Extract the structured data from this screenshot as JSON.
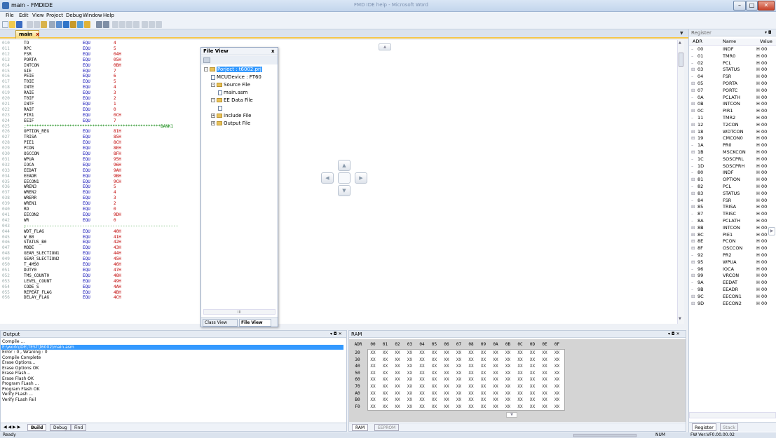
{
  "window": {
    "title": "main - FMDIDE"
  },
  "titlebar": {
    "faded_text": "FMD IDE help - Microsoft Word"
  },
  "menu": [
    "File",
    "Edit",
    "View",
    "Project",
    "Debug",
    "Window",
    "Help"
  ],
  "editor_tab": {
    "label": "main",
    "close": "x"
  },
  "editor": {
    "lines": [
      {
        "n": "010",
        "a": "TO",
        "b": "EQU",
        "c": "4"
      },
      {
        "n": "011",
        "a": "RPC",
        "b": "EQU",
        "c": "5"
      },
      {
        "n": "012",
        "a": "FSR",
        "b": "EQU",
        "c": "04H"
      },
      {
        "n": "013",
        "a": "PORTA",
        "b": "EQU",
        "c": "05H"
      },
      {
        "n": "014",
        "a": "INTCON",
        "b": "EQU",
        "c": "0BH"
      },
      {
        "n": "015",
        "a": "GIE",
        "b": "EQU",
        "c": "7"
      },
      {
        "n": "016",
        "a": "PEIE",
        "b": "EQU",
        "c": "6"
      },
      {
        "n": "017",
        "a": "T0IE",
        "b": "EQU",
        "c": "5"
      },
      {
        "n": "018",
        "a": "INTE",
        "b": "EQU",
        "c": "4"
      },
      {
        "n": "019",
        "a": "RAIE",
        "b": "EQU",
        "c": "3"
      },
      {
        "n": "020",
        "a": "T0IF",
        "b": "EQU",
        "c": "2"
      },
      {
        "n": "021",
        "a": "INTF",
        "b": "EQU",
        "c": "1"
      },
      {
        "n": "022",
        "a": "RAIF",
        "b": "EQU",
        "c": "0"
      },
      {
        "n": "023",
        "a": "PIR1",
        "b": "EQU",
        "c": "0CH"
      },
      {
        "n": "024",
        "a": "EEIF",
        "b": "EQU",
        "c": "7"
      },
      {
        "n": "025",
        "comment": ";*****************************************************BANK1"
      },
      {
        "n": "026",
        "a": "OPTION_REG",
        "b": "EQU",
        "c": "81H"
      },
      {
        "n": "027",
        "a": "TRISA",
        "b": "EQU",
        "c": "85H"
      },
      {
        "n": "028",
        "a": "PIE1",
        "b": "EQU",
        "c": "8CH"
      },
      {
        "n": "029",
        "a": "PCON",
        "b": "EQU",
        "c": "8EH"
      },
      {
        "n": "030",
        "a": "OSCCON",
        "b": "EQU",
        "c": "8FH"
      },
      {
        "n": "031",
        "a": "WPUA",
        "b": "EQU",
        "c": "95H"
      },
      {
        "n": "032",
        "a": "IOCA",
        "b": "EQU",
        "c": "96H"
      },
      {
        "n": "033",
        "a": "EEDAT",
        "b": "EQU",
        "c": "9AH"
      },
      {
        "n": "034",
        "a": "EEADR",
        "b": "EQU",
        "c": "9BH"
      },
      {
        "n": "035",
        "a": "EECON1",
        "b": "EQU",
        "c": "9CH"
      },
      {
        "n": "036",
        "a": "WREN3",
        "b": "EQU",
        "c": "5"
      },
      {
        "n": "037",
        "a": "WREN2",
        "b": "EQU",
        "c": "4"
      },
      {
        "n": "038",
        "a": "WRERR",
        "b": "EQU",
        "c": "3"
      },
      {
        "n": "039",
        "a": "WREN1",
        "b": "EQU",
        "c": "2"
      },
      {
        "n": "040",
        "a": "RD",
        "b": "EQU",
        "c": "0"
      },
      {
        "n": "041",
        "a": "EECON2",
        "b": "EQU",
        "c": "9DH"
      },
      {
        "n": "042",
        "a": "WR",
        "b": "EQU",
        "c": "0"
      },
      {
        "n": "043",
        "comment": ";------------------------------------------------------------"
      },
      {
        "n": "044",
        "a": "WDT_FLAG",
        "b": "EQU",
        "c": "40H"
      },
      {
        "n": "045",
        "a": "W_B0",
        "b": "EQU",
        "c": "41H"
      },
      {
        "n": "046",
        "a": "STATUS_B0",
        "b": "EQU",
        "c": "42H"
      },
      {
        "n": "047",
        "a": "MODE",
        "b": "EQU",
        "c": "43H"
      },
      {
        "n": "048",
        "a": "GEAR_SLECTION1",
        "b": "EQU",
        "c": "44H"
      },
      {
        "n": "049",
        "a": "GEAR_SLECTION2",
        "b": "EQU",
        "c": "45H"
      },
      {
        "n": "050",
        "a": "T_4MS0",
        "b": "EQU",
        "c": "46H"
      },
      {
        "n": "051",
        "a": "DUTY0",
        "b": "EQU",
        "c": "47H"
      },
      {
        "n": "052",
        "a": "TMS_COUNT0",
        "b": "EQU",
        "c": "48H"
      },
      {
        "n": "053",
        "a": "LEVEL_COUNT",
        "b": "EQU",
        "c": "49H"
      },
      {
        "n": "054",
        "a": "CODE_S",
        "b": "EQU",
        "c": "4AH"
      },
      {
        "n": "055",
        "a": "REPEAT_FLAG",
        "b": "EQU",
        "c": "4BH"
      },
      {
        "n": "056",
        "a": "DELAY_FLAG",
        "b": "EQU",
        "c": "4CH"
      }
    ]
  },
  "file_view": {
    "title": "File View",
    "close": "x",
    "tree": [
      {
        "label": "Porject : t6002.prj",
        "level": 0,
        "icon": "folder",
        "selected": true
      },
      {
        "label": "MCUDevice : FT60",
        "level": 1,
        "icon": "chip"
      },
      {
        "label": "Source File",
        "level": 1,
        "icon": "folder"
      },
      {
        "label": "main.asm",
        "level": 2,
        "icon": "doc"
      },
      {
        "label": "EE Data File",
        "level": 1,
        "icon": "folder"
      },
      {
        "label": "",
        "level": 2,
        "icon": "doc"
      },
      {
        "label": "Include File",
        "level": 1,
        "icon": "folder"
      },
      {
        "label": "Output File",
        "level": 1,
        "icon": "folder"
      }
    ],
    "tabs": [
      "Class View",
      "File View"
    ]
  },
  "output": {
    "title": "Output",
    "lines": [
      "Compile ...",
      "E:\\work\\IDE\\TEST\\t6002\\main.asm",
      "Error : 0 , Wraning : 0",
      "Compile Complete",
      "Erase Options...",
      "Erase Options OK",
      "Erase Flash...",
      "Erase Flash OK",
      "Program FLash ...",
      "Program Flash OK",
      "Verify FLash ...",
      "Verify FLash Fail"
    ],
    "highlight_index": 1,
    "tabs": [
      "Build",
      "Debug",
      "Find"
    ]
  },
  "ram": {
    "title": "RAM",
    "corner": "ADR",
    "cols": [
      "00",
      "01",
      "02",
      "03",
      "04",
      "05",
      "06",
      "07",
      "08",
      "09",
      "0A",
      "0B",
      "0C",
      "0D",
      "0E",
      "0F"
    ],
    "rows": [
      "20",
      "30",
      "40",
      "50",
      "60",
      "70",
      "A0",
      "B0",
      "F0"
    ],
    "cell": "XX",
    "tabs": [
      "RAM",
      "EEPROM"
    ]
  },
  "register": {
    "title": "Register",
    "headers": [
      "ADR",
      "Name",
      "Value"
    ],
    "rows": [
      {
        "adr": "00",
        "name": "INDF",
        "val": "H 00",
        "exp": false
      },
      {
        "adr": "01",
        "name": "TMR0",
        "val": "H 00",
        "exp": false
      },
      {
        "adr": "02",
        "name": "PCL",
        "val": "H 00",
        "exp": false
      },
      {
        "adr": "03",
        "name": "STATUS",
        "val": "H 00",
        "exp": true
      },
      {
        "adr": "04",
        "name": "FSR",
        "val": "H 00",
        "exp": false
      },
      {
        "adr": "05",
        "name": "PORTA",
        "val": "H 00",
        "exp": true
      },
      {
        "adr": "07",
        "name": "PORTC",
        "val": "H 00",
        "exp": true
      },
      {
        "adr": "0A",
        "name": "PCLATH",
        "val": "H 00",
        "exp": false
      },
      {
        "adr": "0B",
        "name": "INTCON",
        "val": "H 00",
        "exp": true
      },
      {
        "adr": "0C",
        "name": "PIR1",
        "val": "H 00",
        "exp": true
      },
      {
        "adr": "11",
        "name": "TMR2",
        "val": "H 00",
        "exp": false
      },
      {
        "adr": "12",
        "name": "T2CON",
        "val": "H 00",
        "exp": true
      },
      {
        "adr": "18",
        "name": "WDTCON",
        "val": "H 00",
        "exp": true
      },
      {
        "adr": "19",
        "name": "CMCON0",
        "val": "H 00",
        "exp": true
      },
      {
        "adr": "1A",
        "name": "PR0",
        "val": "H 00",
        "exp": false
      },
      {
        "adr": "1B",
        "name": "MSCKCON",
        "val": "H 00",
        "exp": true
      },
      {
        "adr": "1C",
        "name": "SOSCPRL",
        "val": "H 00",
        "exp": false
      },
      {
        "adr": "1D",
        "name": "SOSCPRH",
        "val": "H 00",
        "exp": false
      },
      {
        "adr": "80",
        "name": "INDF",
        "val": "H 00",
        "exp": false
      },
      {
        "adr": "81",
        "name": "OPTION",
        "val": "H 00",
        "exp": true
      },
      {
        "adr": "82",
        "name": "PCL",
        "val": "H 00",
        "exp": false
      },
      {
        "adr": "83",
        "name": "STATUS",
        "val": "H 00",
        "exp": true
      },
      {
        "adr": "84",
        "name": "FSR",
        "val": "H 00",
        "exp": false
      },
      {
        "adr": "85",
        "name": "TRISA",
        "val": "H 00",
        "exp": true
      },
      {
        "adr": "87",
        "name": "TRISC",
        "val": "H 00",
        "exp": false
      },
      {
        "adr": "8A",
        "name": "PCLATH",
        "val": "H 00",
        "exp": false
      },
      {
        "adr": "8B",
        "name": "INTCON",
        "val": "H 00",
        "exp": true
      },
      {
        "adr": "8C",
        "name": "PIE1",
        "val": "H 00",
        "exp": true
      },
      {
        "adr": "8E",
        "name": "PCON",
        "val": "H 00",
        "exp": true
      },
      {
        "adr": "8F",
        "name": "OSCCON",
        "val": "H 00",
        "exp": true
      },
      {
        "adr": "92",
        "name": "PR2",
        "val": "H 00",
        "exp": false
      },
      {
        "adr": "95",
        "name": "WPUA",
        "val": "H 00",
        "exp": true
      },
      {
        "adr": "96",
        "name": "IOCA",
        "val": "H 00",
        "exp": false
      },
      {
        "adr": "99",
        "name": "VRCON",
        "val": "H 00",
        "exp": true
      },
      {
        "adr": "9A",
        "name": "EEDAT",
        "val": "H 00",
        "exp": false
      },
      {
        "adr": "9B",
        "name": "EEADR",
        "val": "H 00",
        "exp": false
      },
      {
        "adr": "9C",
        "name": "EECON1",
        "val": "H 00",
        "exp": true
      },
      {
        "adr": "9D",
        "name": "EECON2",
        "val": "H 00",
        "exp": true
      }
    ],
    "tabs": [
      "Register",
      "Stack"
    ]
  },
  "status": {
    "left": "Ready",
    "num": "NUM",
    "version": "FW Ver:VF0.00.00.02"
  },
  "colors": {
    "accent": "#f5c64a",
    "selection": "#3399ff",
    "keyword": "#0000b0",
    "number": "#c00000",
    "comment": "#008000"
  }
}
